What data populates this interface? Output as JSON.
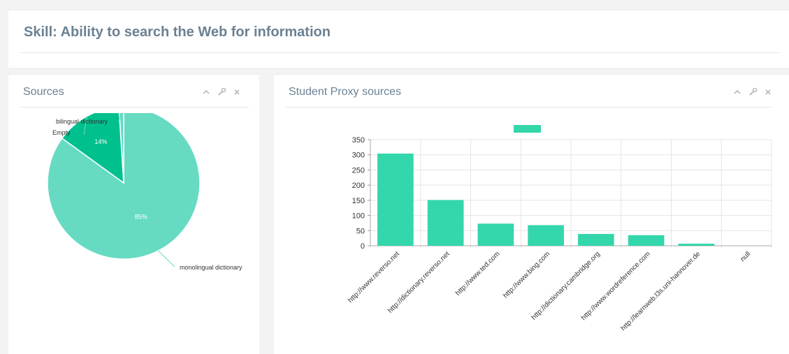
{
  "page": {
    "title": "Skill: Ability to search the Web for information"
  },
  "panels": {
    "sources": {
      "title": "Sources",
      "tools": [
        "chevron-up-icon",
        "wrench-icon",
        "close-icon"
      ]
    },
    "proxy": {
      "title": "Student Proxy sources",
      "tools": [
        "chevron-up-icon",
        "wrench-icon",
        "close-icon"
      ]
    }
  },
  "colors": {
    "accent": "#34d6ab",
    "pie_main": "#66dbc2",
    "pie_secondary": "#00c08e",
    "title": "#6b8193"
  },
  "chart_data": [
    {
      "type": "pie",
      "title": "",
      "slices": [
        {
          "label": "monolingual dictionary",
          "value": 85,
          "display": "85%"
        },
        {
          "label": "Empty",
          "value": 14,
          "display": "14%"
        },
        {
          "label": "bilingual dictionary",
          "value": 1,
          "display": ""
        }
      ]
    },
    {
      "type": "bar",
      "title": "",
      "legend": "top-center",
      "categories": [
        "http://www.reverso.net",
        "http://dictionary.reverso.net",
        "http://www.ted.com",
        "http://www.bing.com",
        "http://dictionary.cambridge.org",
        "http://www.wordreference.com",
        "http://learnweb.l3s.uni-hannover.de",
        "null"
      ],
      "values": [
        304,
        151,
        73,
        68,
        39,
        35,
        7,
        0
      ],
      "ylim": [
        0,
        350
      ],
      "yticks": [
        0,
        50,
        100,
        150,
        200,
        250,
        300,
        350
      ],
      "grid": true
    }
  ]
}
